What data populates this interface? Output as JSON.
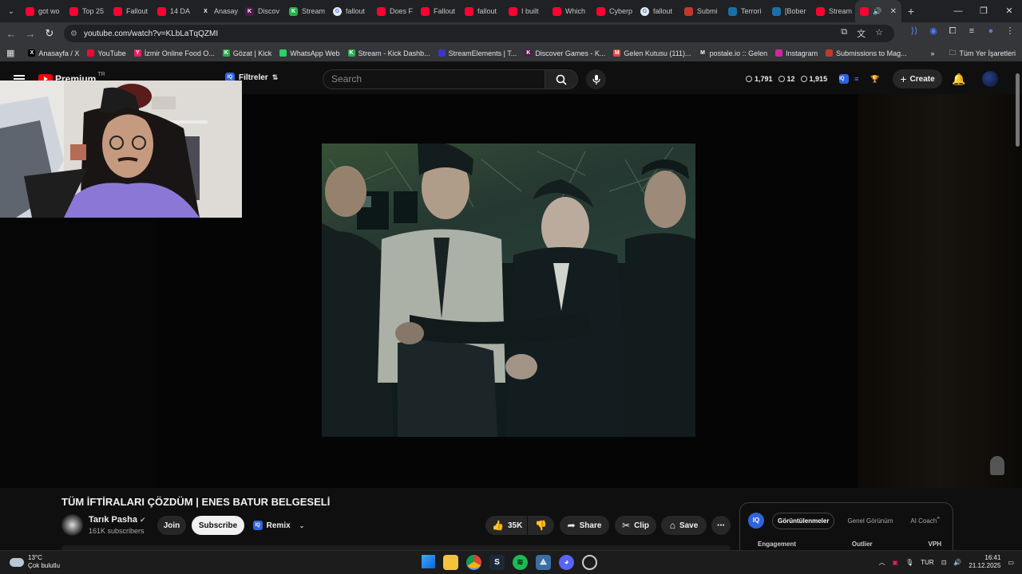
{
  "browser": {
    "tabs": [
      {
        "title": "got wo",
        "fav_color": "#ff0033",
        "fav": ""
      },
      {
        "title": "Top 25",
        "fav_color": "#ff0033",
        "fav": ""
      },
      {
        "title": "Fallout",
        "fav_color": "#ff0033",
        "fav": ""
      },
      {
        "title": "14 DA",
        "fav_color": "#ff0033",
        "fav": ""
      },
      {
        "title": "Anasay",
        "fav_color": "#202124",
        "fav": "X"
      },
      {
        "title": "Discov",
        "fav_color": "#53164a",
        "fav": "K"
      },
      {
        "title": "Stream",
        "fav_color": "#26b34a",
        "fav": "K"
      },
      {
        "title": "fallout",
        "fav_color": "#e8eaed",
        "fav": "G"
      },
      {
        "title": "Does F",
        "fav_color": "#ff0033",
        "fav": ""
      },
      {
        "title": "Fallout",
        "fav_color": "#ff0033",
        "fav": ""
      },
      {
        "title": "fallout",
        "fav_color": "#ff0033",
        "fav": ""
      },
      {
        "title": "I built",
        "fav_color": "#ff0033",
        "fav": ""
      },
      {
        "title": "Which",
        "fav_color": "#ff0033",
        "fav": ""
      },
      {
        "title": "Cyberp",
        "fav_color": "#ff0033",
        "fav": ""
      },
      {
        "title": "fallout",
        "fav_color": "#e8eaed",
        "fav": "G"
      },
      {
        "title": "Submi",
        "fav_color": "#c0392b",
        "fav": ""
      },
      {
        "title": "Terrori",
        "fav_color": "#1b6fa8",
        "fav": ""
      },
      {
        "title": "[Bober",
        "fav_color": "#1b6fa8",
        "fav": ""
      },
      {
        "title": "Stream",
        "fav_color": "#ff0033",
        "fav": ""
      }
    ],
    "url": "youtube.com/watch?v=KLbLaTqQZMI",
    "bookmarks": [
      {
        "label": "Anasayfa / X",
        "color": "#000000",
        "glyph": "X"
      },
      {
        "label": "YouTube",
        "color": "#ff0033",
        "glyph": ""
      },
      {
        "label": "İzmir Online Food O...",
        "color": "#e91e63",
        "glyph": "Y"
      },
      {
        "label": "Gözat | Kick",
        "color": "#26b34a",
        "glyph": "K"
      },
      {
        "label": "WhatsApp Web",
        "color": "#25d366",
        "glyph": ""
      },
      {
        "label": "Stream - Kick Dashb...",
        "color": "#26b34a",
        "glyph": "K"
      },
      {
        "label": "StreamElements | T...",
        "color": "#3b35c9",
        "glyph": ""
      },
      {
        "label": "Discover Games - K...",
        "color": "#53164a",
        "glyph": "K"
      },
      {
        "label": "Gelen Kutusu (111)...",
        "color": "#ea4335",
        "glyph": "M"
      },
      {
        "label": "postale.io :: Gelen",
        "color": "#333333",
        "glyph": "M"
      },
      {
        "label": "Instagram",
        "color": "#d6249f",
        "glyph": ""
      },
      {
        "label": "Submissions to Mag...",
        "color": "#c0392b",
        "glyph": ""
      }
    ],
    "all_bookmarks": "Tüm Yer İşaretleri"
  },
  "youtube": {
    "logo_text": "Premium",
    "logo_region": "TR",
    "filters_label": "Filtreler",
    "search_placeholder": "Search",
    "stats": {
      "views": "1,791",
      "likes": "12",
      "subs": "1,915"
    },
    "create_label": "Create",
    "video_title": "TÜM İFTİRALARI ÇÖZDÜM | ENES BATUR BELGESELİ",
    "channel_name": "Tarık Pasha",
    "subscribers": "161K subscribers",
    "join_label": "Join",
    "subscribe_label": "Subscribe",
    "remix_label": "Remix",
    "like_count": "35K",
    "share_label": "Share",
    "clip_label": "Clip",
    "save_label": "Save",
    "panel": {
      "tabs": [
        "Görüntülenmeler",
        "Genel Görünüm",
        "AI Coach"
      ],
      "cols": [
        "Engagement",
        "Outlier",
        "VPH"
      ]
    }
  },
  "taskbar": {
    "temp": "13°C",
    "weather": "Çok bulutlu",
    "lang": "TUR",
    "time": "16:41",
    "date": "21.12.2025"
  }
}
